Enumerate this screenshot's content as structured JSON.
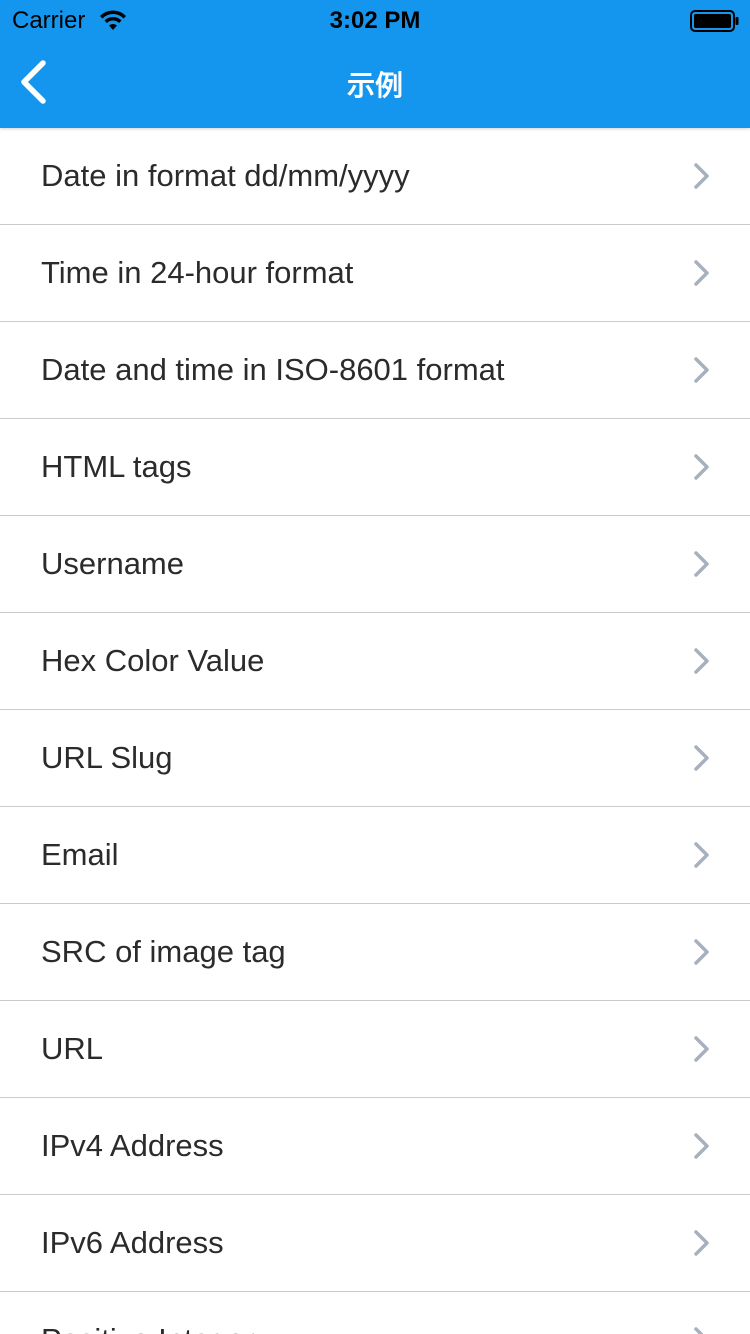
{
  "status_bar": {
    "carrier": "Carrier",
    "time": "3:02 PM",
    "wifi_icon": "wifi-icon",
    "battery_icon": "battery-icon"
  },
  "nav": {
    "title": "示例",
    "back_icon": "chevron-left-icon"
  },
  "colors": {
    "accent": "#1596ee",
    "row_text": "#2b2b2b",
    "chevron": "#a7b1bd",
    "separator": "#c9c9ce"
  },
  "list": {
    "chevron_icon": "chevron-right-icon",
    "items": [
      {
        "label": "Date in format dd/mm/yyyy"
      },
      {
        "label": "Time in 24-hour format"
      },
      {
        "label": "Date and time in ISO-8601 format"
      },
      {
        "label": "HTML tags"
      },
      {
        "label": "Username"
      },
      {
        "label": "Hex Color Value"
      },
      {
        "label": "URL Slug"
      },
      {
        "label": "Email"
      },
      {
        "label": "SRC of image tag"
      },
      {
        "label": "URL"
      },
      {
        "label": "IPv4 Address"
      },
      {
        "label": "IPv6 Address"
      },
      {
        "label": "Positive Integer"
      }
    ]
  }
}
